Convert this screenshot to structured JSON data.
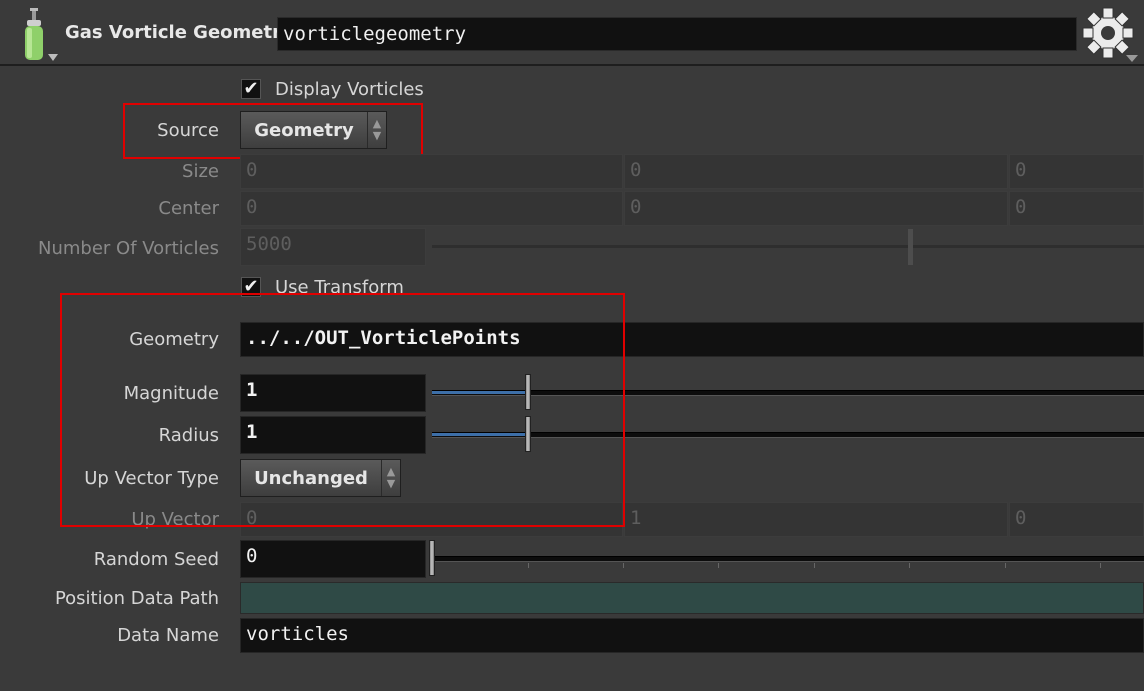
{
  "header": {
    "node_type": "Gas Vorticle Geometry",
    "node_name": "vorticlegeometry"
  },
  "icons": {
    "node_icon": "gas-cylinder-icon",
    "gear": "gear-icon"
  },
  "params": {
    "display_vorticles": {
      "label": "Display Vorticles",
      "checked": true
    },
    "source": {
      "label": "Source",
      "value": "Geometry"
    },
    "size": {
      "label": "Size",
      "values": [
        "0",
        "0",
        "0"
      ]
    },
    "center": {
      "label": "Center",
      "values": [
        "0",
        "0",
        "0"
      ]
    },
    "num_vorticles": {
      "label": "Number Of Vorticles",
      "value": "5000"
    },
    "use_transform": {
      "label": "Use Transform",
      "checked": true
    },
    "geometry": {
      "label": "Geometry",
      "value": "../../OUT_VorticlePoints"
    },
    "magnitude": {
      "label": "Magnitude",
      "value": "1",
      "slider_fraction": 0.1
    },
    "radius": {
      "label": "Radius",
      "value": "1",
      "slider_fraction": 0.1
    },
    "up_vector_type": {
      "label": "Up Vector Type",
      "value": "Unchanged"
    },
    "up_vector": {
      "label": "Up Vector",
      "values": [
        "0",
        "1",
        "0"
      ]
    },
    "random_seed": {
      "label": "Random Seed",
      "value": "0",
      "slider_fraction": 0.0
    },
    "position_data_path": {
      "label": "Position Data Path",
      "value": ""
    },
    "data_name": {
      "label": "Data Name",
      "value": "vorticles"
    }
  },
  "colors": {
    "background": "#3a3a3a",
    "field": "#111111",
    "slider_fill": "#3d6fa8",
    "highlight": "#e00000",
    "data_path": "#2f4a46"
  }
}
